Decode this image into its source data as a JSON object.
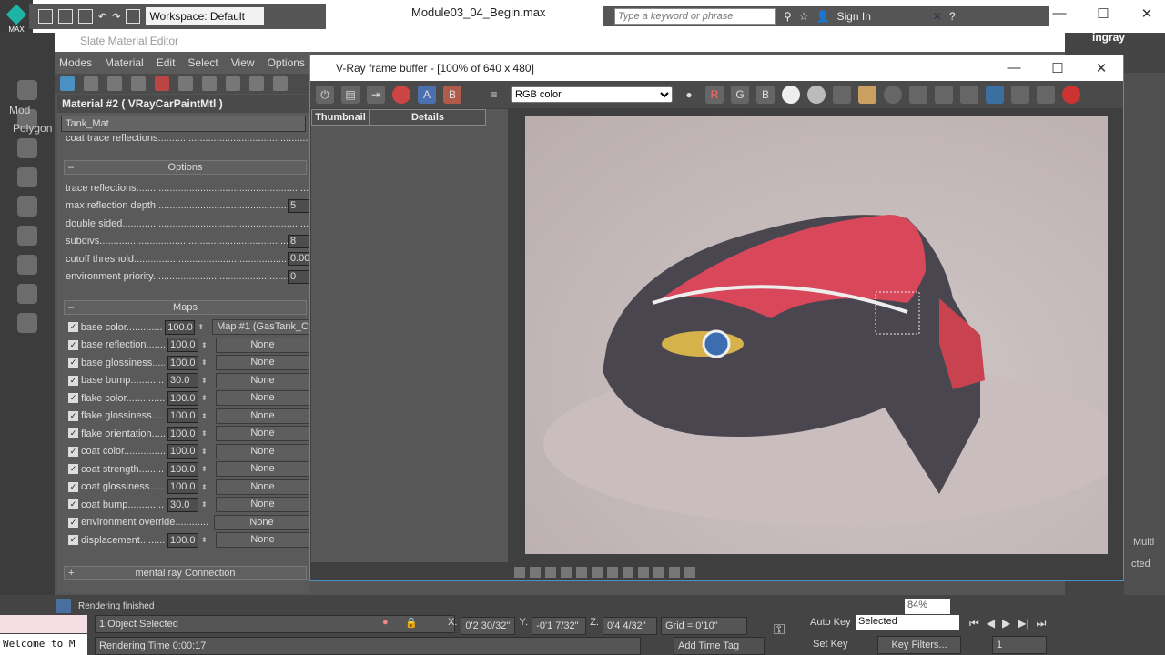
{
  "app": {
    "title": "Module03_04_Begin.max",
    "logo_text": "MAX",
    "workspace": "Workspace: Default",
    "search_placeholder": "Type a keyword or phrase",
    "sign_in": "Sign In",
    "right_label": "ingray"
  },
  "sme": {
    "title": "Slate Material Editor",
    "menu": [
      "Modes",
      "Material",
      "Edit",
      "Select",
      "View",
      "Options"
    ],
    "material_header": "Material #2  ( VRayCarPaintMtl )",
    "material_name": "Tank_Mat",
    "coat_trace": "coat trace reflections",
    "options_title": "Options",
    "options": [
      {
        "label": "trace reflections",
        "value": null
      },
      {
        "label": "max reflection depth",
        "value": "5"
      },
      {
        "label": "double sided",
        "value": null
      },
      {
        "label": "subdivs",
        "value": "8"
      },
      {
        "label": "cutoff threshold",
        "value": "0.00"
      },
      {
        "label": "environment priority",
        "value": "0"
      }
    ],
    "maps_title": "Maps",
    "maps": [
      {
        "label": "base color",
        "amount": "100.0",
        "map": "Map #1 (GasTank_C"
      },
      {
        "label": "base reflection",
        "amount": "100.0",
        "map": "None"
      },
      {
        "label": "base glossiness",
        "amount": "100.0",
        "map": "None"
      },
      {
        "label": "base bump",
        "amount": "30.0",
        "map": "None"
      },
      {
        "label": "flake color",
        "amount": "100.0",
        "map": "None"
      },
      {
        "label": "flake glossiness",
        "amount": "100.0",
        "map": "None"
      },
      {
        "label": "flake orientation",
        "amount": "100.0",
        "map": "None"
      },
      {
        "label": "coat color",
        "amount": "100.0",
        "map": "None"
      },
      {
        "label": "coat strength",
        "amount": "100.0",
        "map": "None"
      },
      {
        "label": "coat glossiness",
        "amount": "100.0",
        "map": "None"
      },
      {
        "label": "coat bump",
        "amount": "30.0",
        "map": "None"
      },
      {
        "label": "environment override",
        "amount": null,
        "map": "None"
      },
      {
        "label": "displacement",
        "amount": "100.0",
        "map": "None"
      }
    ],
    "mental_ray": "mental ray Connection",
    "left_tabs": [
      "Mod",
      "Polygon"
    ]
  },
  "vfb": {
    "title": "V-Ray frame buffer - [100% of 640 x 480]",
    "channel": "RGB color",
    "r": "R",
    "g": "G",
    "b": "B",
    "a": "A",
    "bb": "B",
    "tab_thumbnail": "Thumbnail",
    "tab_details": "Details"
  },
  "status": {
    "rendering_finished": "Rendering finished",
    "selected": "1 Object Selected",
    "render_time": "Rendering Time  0:00:17",
    "x": "0'2 30/32\"",
    "y": "-0'1 7/32\"",
    "z": "0'4 4/32\"",
    "grid": "Grid = 0'10\"",
    "add_time_tag": "Add Time Tag",
    "auto_key": "Auto Key",
    "set_key": "Set Key",
    "key_mode": "Selected",
    "key_filters": "Key Filters...",
    "frame": "1",
    "zoom": "84%",
    "welcome": "Welcome to M",
    "right_multi": "Multi",
    "right_cted": "cted"
  },
  "colors": {
    "accent": "#4a90c0",
    "paint": "#d8475a"
  }
}
